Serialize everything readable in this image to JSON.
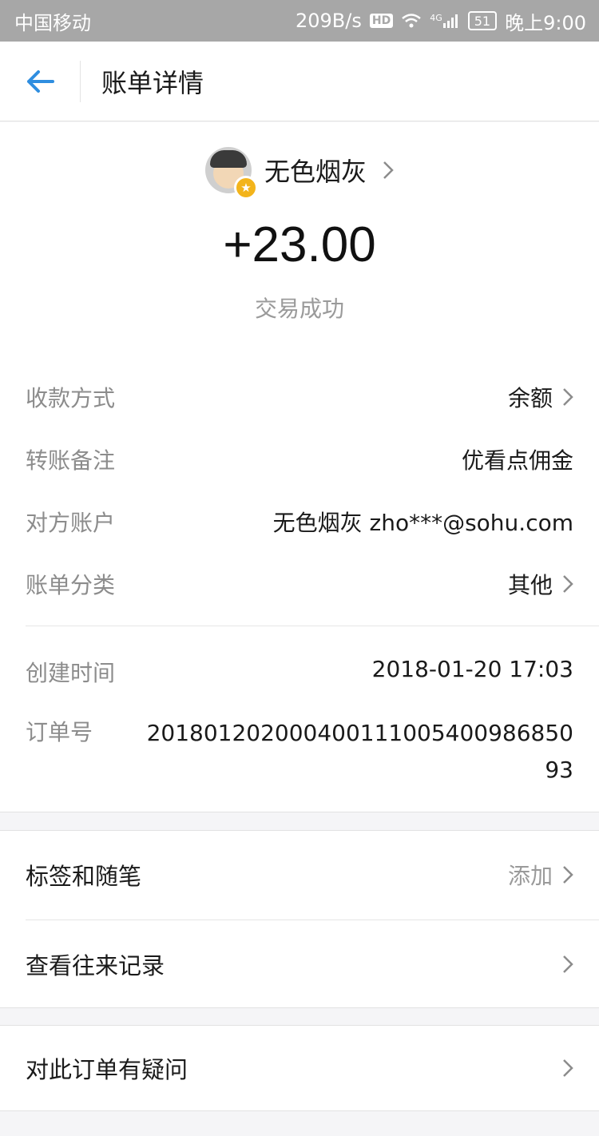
{
  "status_bar": {
    "carrier": "中国移动",
    "speed": "209B/s",
    "hd": "HD",
    "network": "4G",
    "battery": "51",
    "time": "晚上9:00"
  },
  "nav": {
    "title": "账单详情"
  },
  "payer": {
    "name": "无色烟灰"
  },
  "amount": "+23.00",
  "status": "交易成功",
  "details": [
    {
      "label": "收款方式",
      "value": "余额"
    },
    {
      "label": "转账备注",
      "value": "优看点佣金"
    },
    {
      "label": "对方账户",
      "value": "无色烟灰 zho***@sohu.com"
    },
    {
      "label": "账单分类",
      "value": "其他"
    }
  ],
  "meta": [
    {
      "label": "创建时间",
      "value": "2018-01-20 17:03"
    },
    {
      "label": "订单号",
      "value": "2018012020004001110054009868509 3"
    }
  ],
  "order_number": {
    "line1": "201801202000400111005400986850",
    "line2": "93"
  },
  "actions": {
    "tags_label": "标签和随笔",
    "tags_action": "添加",
    "history_label": "查看往来记录",
    "question_label": "对此订单有疑问"
  },
  "colors": {
    "accent": "#2f8ee0",
    "status_bar": "#a7a7a7",
    "badge": "#f3b41b"
  }
}
